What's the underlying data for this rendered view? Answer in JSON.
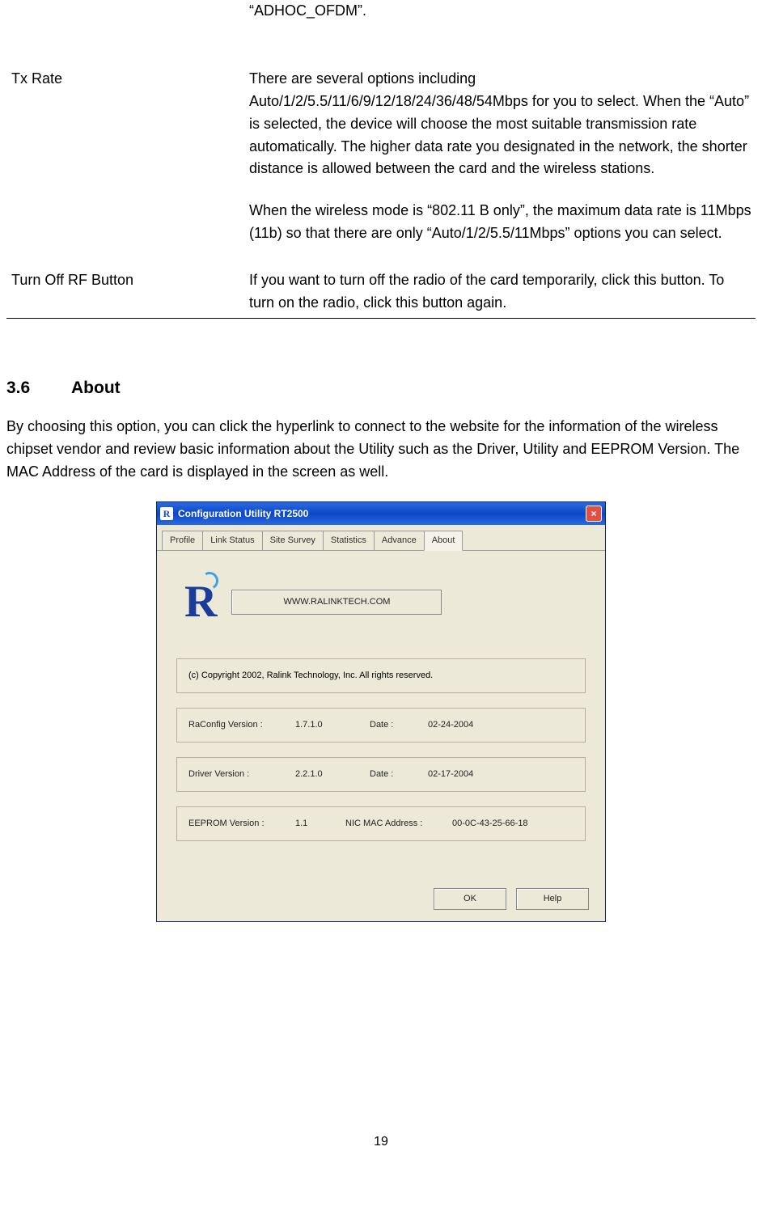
{
  "table": {
    "row0": {
      "label": "",
      "desc": "“ADHOC_OFDM”."
    },
    "row1": {
      "label": "Tx Rate",
      "p1": "There are several options including Auto/1/2/5.5/11/6/9/12/18/24/36/48/54Mbps for you to select. When the “Auto” is selected, the device will choose the most suitable transmission rate automatically. The higher data rate you designated in the network, the shorter distance is allowed between the card and the wireless stations.",
      "p2": "When the wireless mode is “802.11 B only”, the maximum data rate is 11Mbps (11b) so that there are only “Auto/1/2/5.5/11Mbps” options you can select."
    },
    "row2": {
      "label": "Turn Off RF Button",
      "p1": "If you want to turn off the radio of the card temporarily, click this button. To turn on the radio, click this button again."
    }
  },
  "section": {
    "num": "3.6",
    "title": "About",
    "body": "By choosing this option, you can click the hyperlink to connect to the website for the information of the wireless chipset vendor and review basic information about the Utility such as the Driver, Utility and EEPROM Version. The MAC Address of the card is displayed in the screen as well."
  },
  "dialog": {
    "title": "Configuration Utility RT2500",
    "close": "×",
    "tabs": [
      "Profile",
      "Link Status",
      "Site Survey",
      "Statistics",
      "Advance",
      "About"
    ],
    "active_tab": "About",
    "logo": "R",
    "link": "WWW.RALINKTECH.COM",
    "copyright": "(c) Copyright 2002, Ralink Technology, Inc.  All rights reserved.",
    "raconfig": {
      "label": "RaConfig Version :",
      "value": "1.7.1.0",
      "date_label": "Date :",
      "date": "02-24-2004"
    },
    "driver": {
      "label": "Driver Version :",
      "value": "2.2.1.0",
      "date_label": "Date :",
      "date": "02-17-2004"
    },
    "eeprom": {
      "label": "EEPROM Version :",
      "value": "1.1",
      "mac_label": "NIC MAC Address :",
      "mac": "00-0C-43-25-66-18"
    },
    "ok": "OK",
    "help": "Help"
  },
  "page_number": "19"
}
